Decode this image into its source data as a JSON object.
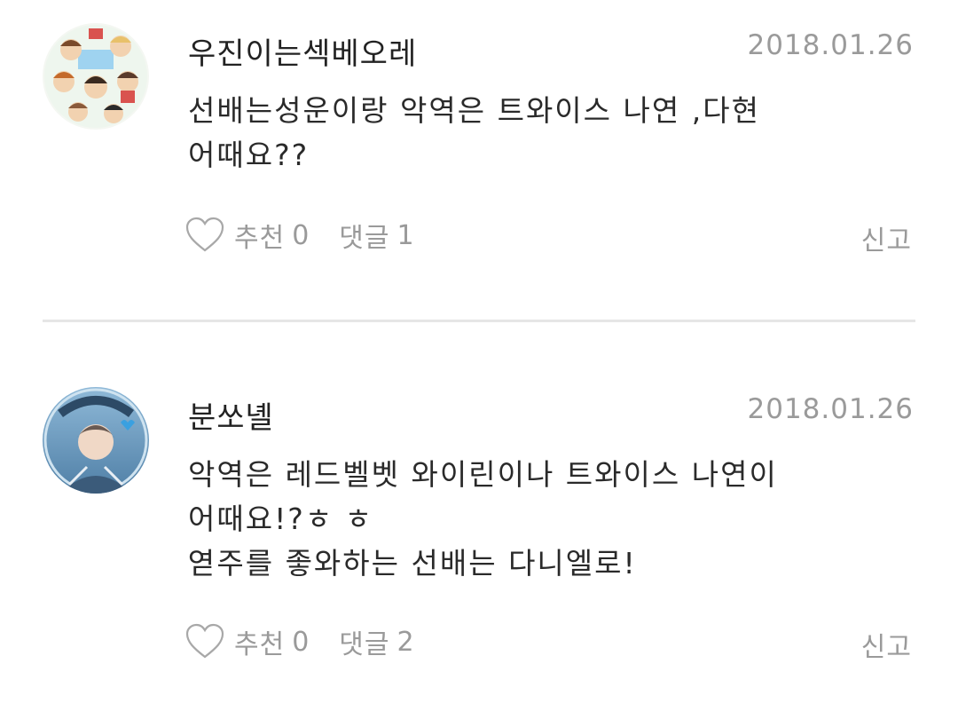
{
  "comments": [
    {
      "author": "우진이는섹베오레",
      "date": "2018.01.26",
      "lines": [
        "선배는성운이랑 악역은 트와이스 나연 ,다현",
        "어때요??"
      ],
      "like_label": "추천",
      "like_count": "0",
      "reply_label": "댓글",
      "reply_count": "1",
      "report_label": "신고",
      "avatar_icon": "cartoon-group-avatar"
    },
    {
      "author": "분쏘녤",
      "date": "2018.01.26",
      "lines": [
        "악역은 레드벨벳 와이린이나 트와이스 나연이",
        "어때요!?ㅎ ㅎ",
        "엳주를 좋와하는 선배는 다니엘로!"
      ],
      "like_label": "추천",
      "like_count": "0",
      "reply_label": "댓글",
      "reply_count": "2",
      "report_label": "신고",
      "avatar_icon": "photo-avatar"
    }
  ],
  "colors": {
    "text": "#2a2a2a",
    "meta": "#9a9a9a",
    "divider": "#e6e6e6"
  }
}
